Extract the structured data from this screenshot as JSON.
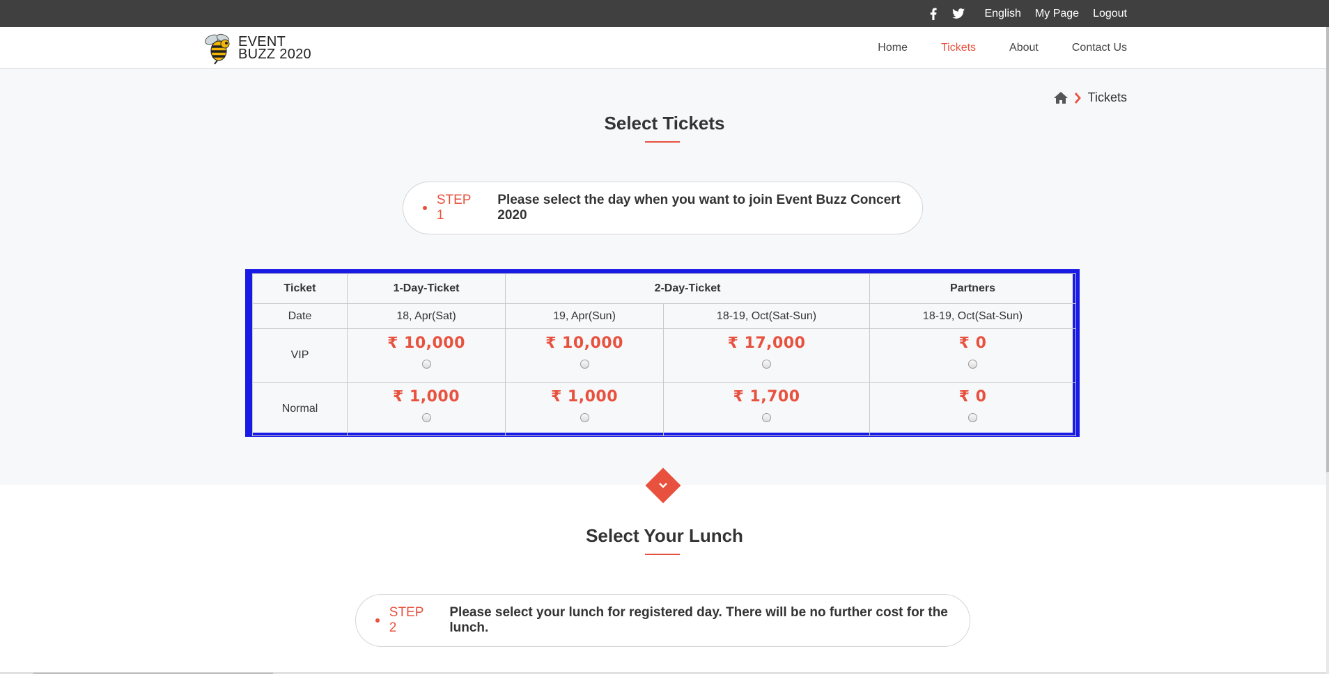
{
  "topbar": {
    "social": [
      "facebook-icon",
      "twitter-icon"
    ],
    "links": [
      "English",
      "My Page",
      "Logout"
    ]
  },
  "brand": {
    "line1": "EVENT",
    "line2": "BUZZ 2020"
  },
  "nav": {
    "items": [
      "Home",
      "Tickets",
      "About",
      "Contact Us"
    ],
    "active": "Tickets"
  },
  "breadcrumb": {
    "current": "Tickets"
  },
  "section1": {
    "title": "Select Tickets",
    "step_label": "STEP 1",
    "step_text": "Please select the day when you want to join Event Buzz Concert 2020"
  },
  "table": {
    "header": [
      "Ticket",
      "1-Day-Ticket",
      "2-Day-Ticket",
      "Partners"
    ],
    "date_label": "Date",
    "dates": [
      "18, Apr(Sat)",
      "19, Apr(Sun)",
      "18-19, Oct(Sat-Sun)",
      "18-19, Oct(Sat-Sun)"
    ],
    "rows": [
      {
        "label": "VIP",
        "prices": [
          "₹ 10,000",
          "₹ 10,000",
          "₹ 17,000",
          "₹ 0"
        ]
      },
      {
        "label": "Normal",
        "prices": [
          "₹ 1,000",
          "₹ 1,000",
          "₹ 1,700",
          "₹ 0"
        ]
      }
    ]
  },
  "section2": {
    "title": "Select Your Lunch",
    "step_label": "STEP 2",
    "step_text": "Please select your lunch for registered day. There will be no further cost for the lunch."
  },
  "colors": {
    "accent": "#e8513e",
    "topbar": "#404040",
    "table_highlight": "#1a1ae6"
  }
}
